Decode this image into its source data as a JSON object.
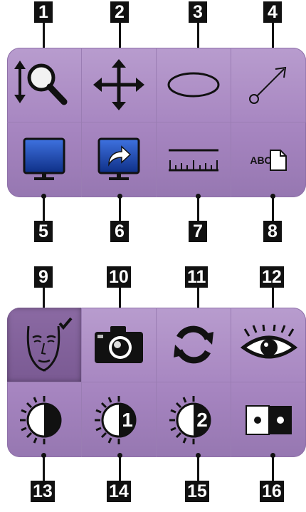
{
  "callouts": {
    "c1": "1",
    "c2": "2",
    "c3": "3",
    "c4": "4",
    "c5": "5",
    "c6": "6",
    "c7": "7",
    "c8": "8",
    "c9": "9",
    "c10": "10",
    "c11": "11",
    "c12": "12",
    "c13": "13",
    "c14": "14",
    "c15": "15",
    "c16": "16"
  },
  "tools": {
    "text_annotation_label": "ABC",
    "brightness_preset_1": "1",
    "brightness_preset_2": "2"
  },
  "colors": {
    "panel": "#a685c0",
    "panel_selected": "#7a5a93",
    "monitor_blue": "#1f4fb8",
    "icon": "#111111"
  },
  "icons": [
    "zoom-magnifier-icon",
    "pan-move-icon",
    "ellipse-roi-icon",
    "arrow-annotation-icon",
    "monitor-icon",
    "monitor-send-icon",
    "ruler-icon",
    "text-annotation-icon",
    "face-check-icon",
    "camera-icon",
    "refresh-icon",
    "eye-icon",
    "brightness-contrast-icon",
    "brightness-preset-1-icon",
    "brightness-preset-2-icon",
    "dual-dot-icon"
  ]
}
